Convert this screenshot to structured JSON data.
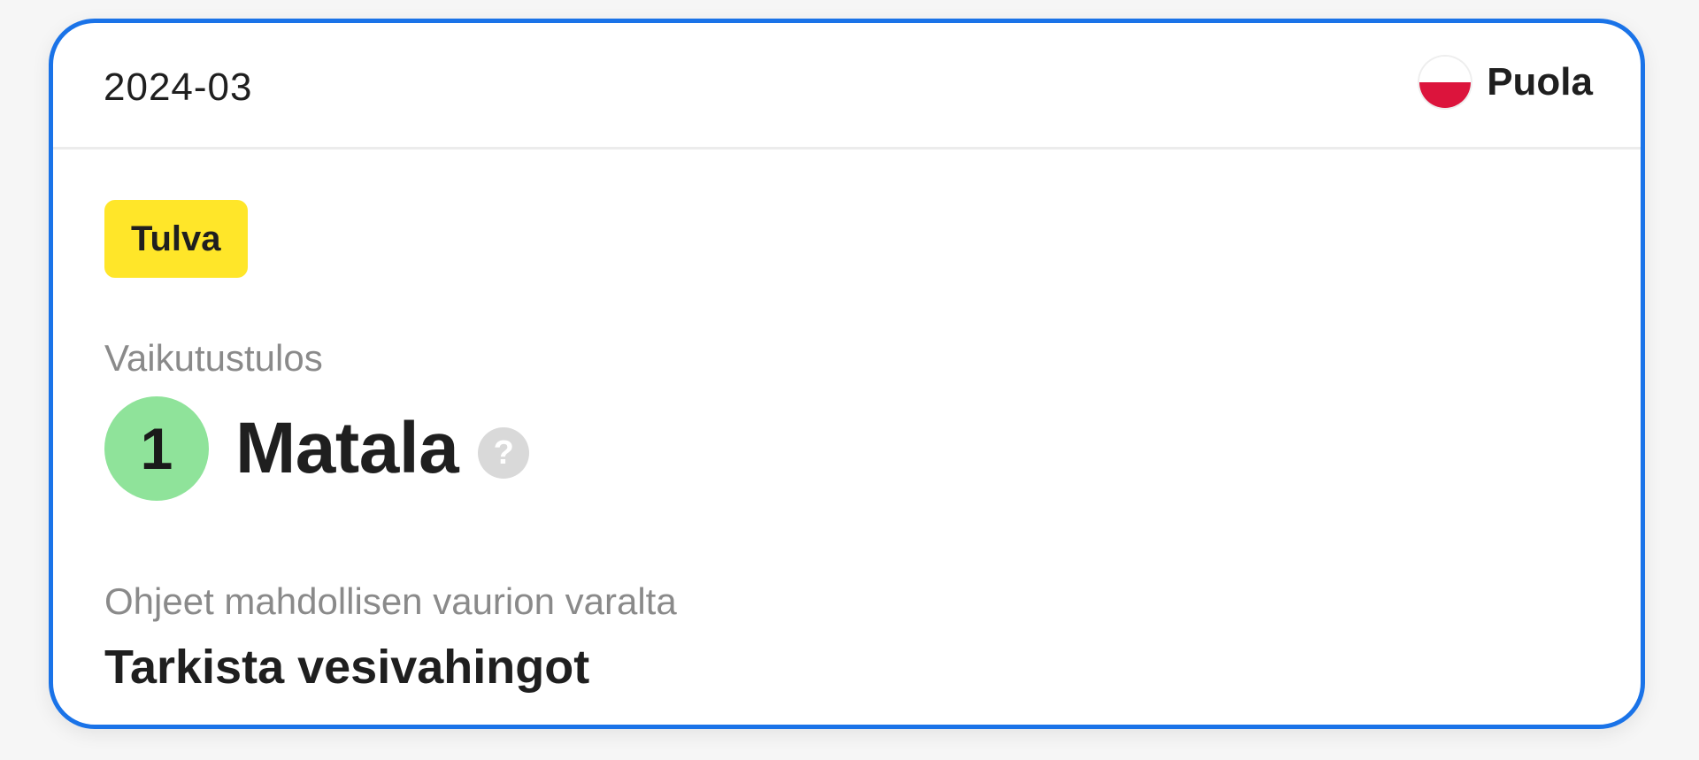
{
  "card": {
    "date": "2024-03",
    "country": {
      "name": "Puola",
      "flag_icon": "poland-flag-icon",
      "flag_colors": [
        "#ffffff",
        "#dc143c"
      ]
    },
    "event_tag": "Tulva",
    "impact": {
      "label": "Vaikutustulos",
      "score": "1",
      "level": "Matala",
      "help_icon": "?"
    },
    "instructions": {
      "label": "Ohjeet mahdollisen vaurion varalta",
      "value": "Tarkista vesivahingot"
    }
  },
  "colors": {
    "border_accent": "#1a73e8",
    "tag_background": "#ffe629",
    "score_background": "#8fe39a",
    "muted_text": "#8a8a8a"
  }
}
